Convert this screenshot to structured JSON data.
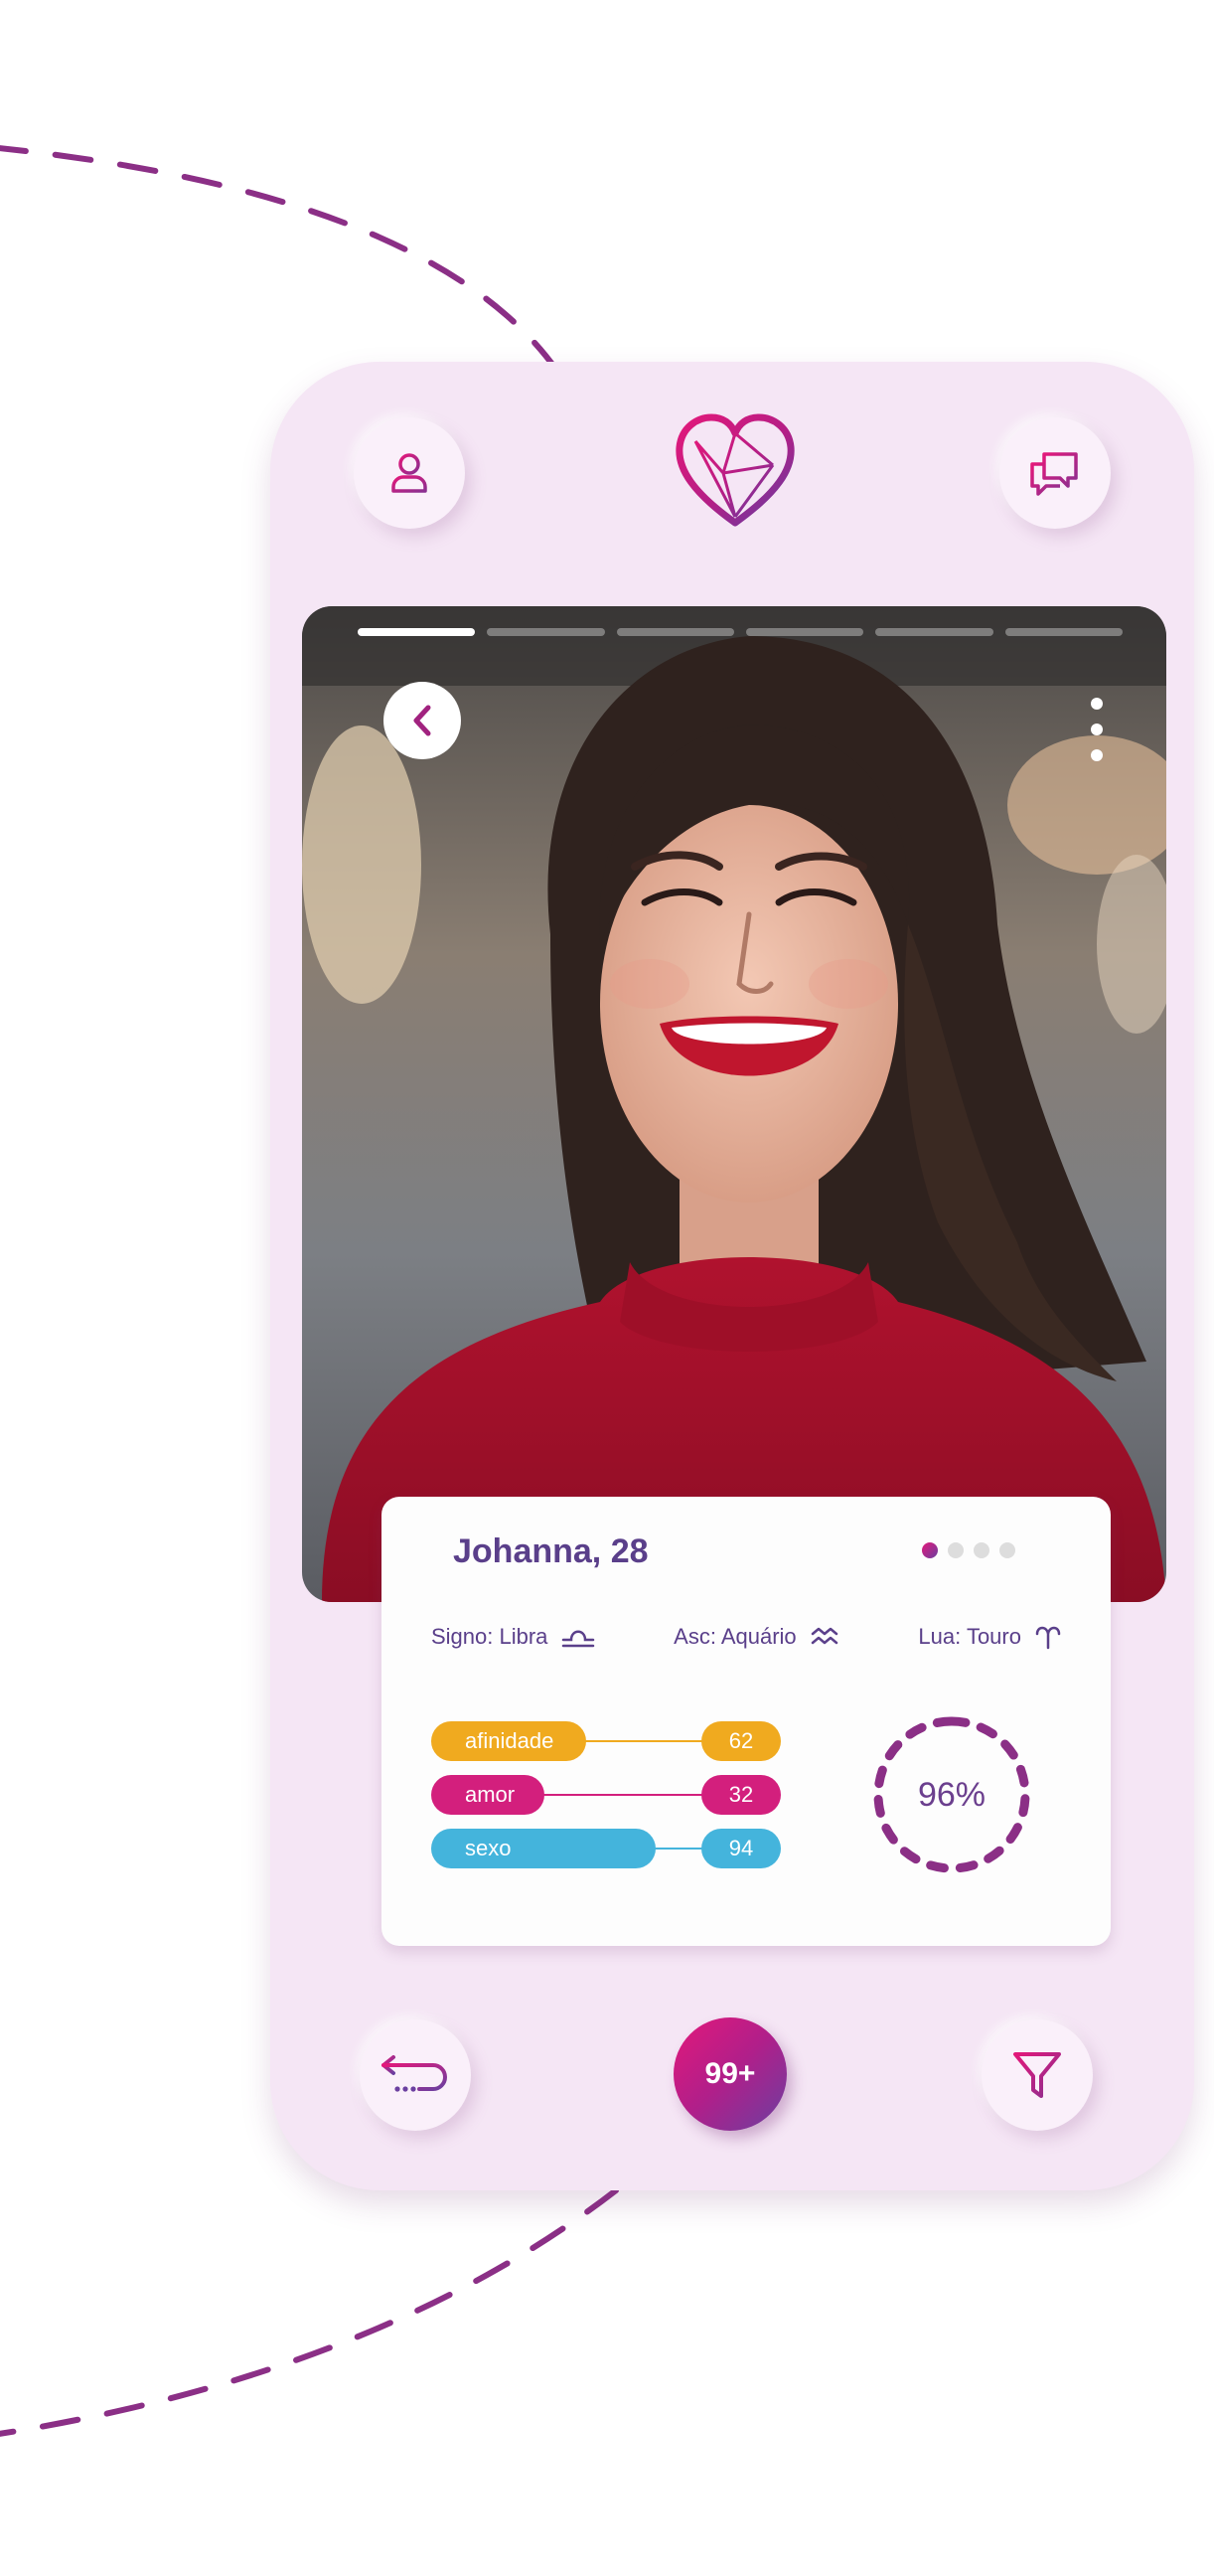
{
  "header": {
    "profile_icon": "user-icon",
    "logo_icon": "heart-logo-icon",
    "chat_icon": "chat-bubbles-icon"
  },
  "photo": {
    "progress_segments": 6,
    "active_segment": 1,
    "back_icon": "chevron-left-icon",
    "more_icon": "more-vertical-icon"
  },
  "profile": {
    "name": "Johanna, 28",
    "carousel_dots": 4,
    "active_dot": 1,
    "signs": [
      {
        "label": "Signo: Libra",
        "icon": "libra-icon"
      },
      {
        "label": "Asc: Aquário",
        "icon": "aquarius-icon"
      },
      {
        "label": "Lua: Touro",
        "icon": "taurus-icon"
      }
    ],
    "metrics": [
      {
        "label": "afinidade",
        "value": "62",
        "color": "#f0aa1f"
      },
      {
        "label": "amor",
        "value": "32",
        "color": "#d31f7d"
      },
      {
        "label": "sexo",
        "value": "94",
        "color": "#44b4dc"
      }
    ],
    "match_percent": "96%",
    "match_fraction": 0.96
  },
  "footer": {
    "undo_icon": "undo-icon",
    "notifications_count": "99+",
    "filter_icon": "filter-icon"
  },
  "colors": {
    "brand_pink": "#e3187a",
    "brand_purple": "#6b3fa0",
    "phone_bg": "#f5e6f5",
    "text_purple": "#5a3f8a"
  }
}
